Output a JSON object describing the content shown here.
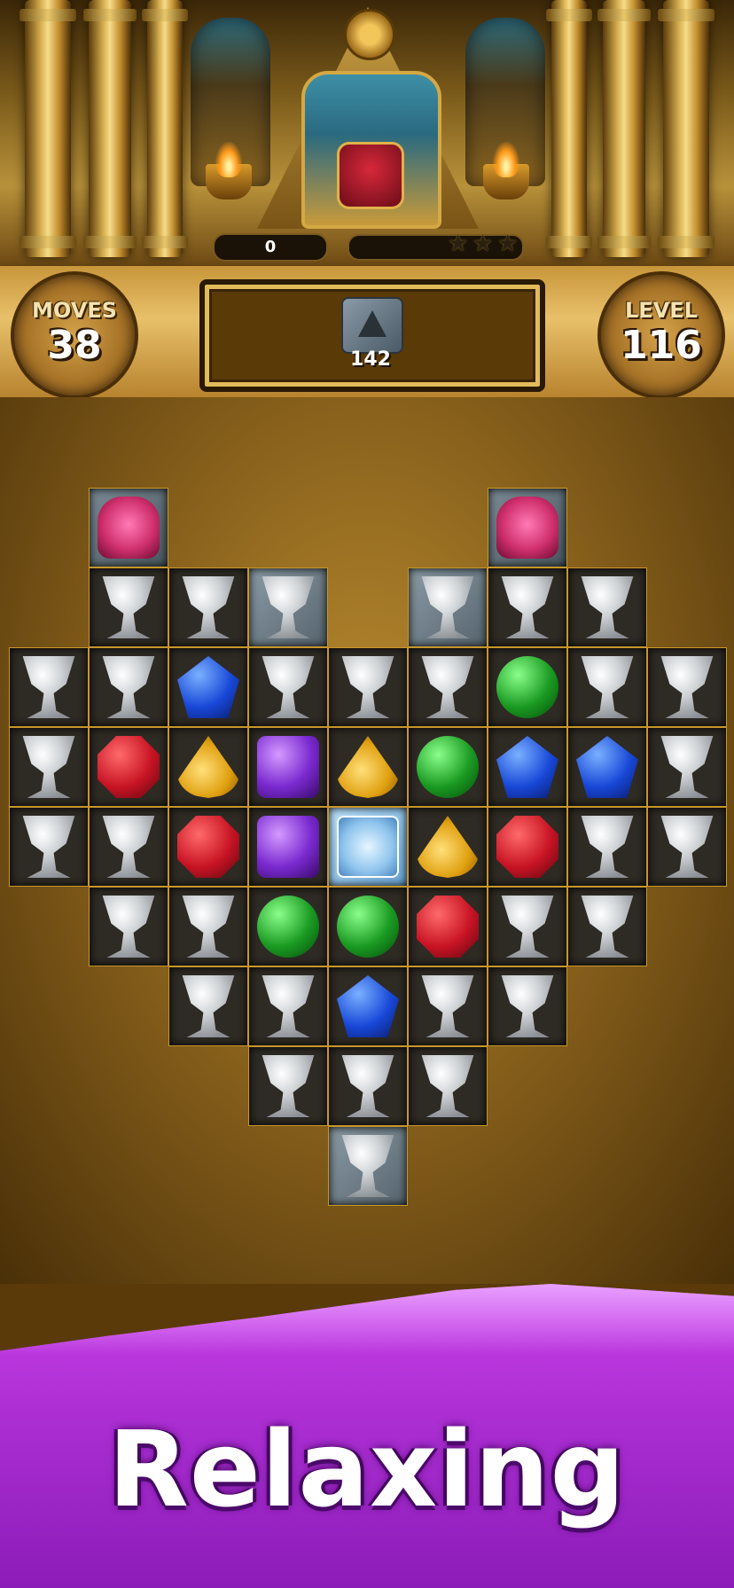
{
  "scene": {
    "score": "0",
    "progress": 0,
    "stars_total": 3,
    "stars_earned": 0
  },
  "hud": {
    "moves_label": "MOVES",
    "moves_value": "38",
    "level_label": "LEVEL",
    "level_value": "116",
    "goal": {
      "icon": "stone-block-icon",
      "count": "142"
    }
  },
  "board": {
    "rows": [
      [
        null,
        "scarab",
        null,
        null,
        null,
        null,
        "scarab",
        null,
        null
      ],
      [
        null,
        "chalice",
        "chalice",
        "chalice",
        null,
        "chalice",
        "chalice",
        "chalice",
        null
      ],
      [
        "chalice",
        "chalice",
        "blue",
        "chalice",
        "chalice",
        "chalice",
        "green",
        "chalice",
        "chalice"
      ],
      [
        "chalice",
        "red",
        "yellow",
        "purple",
        "yellow",
        "green",
        "blue",
        "blue",
        "chalice"
      ],
      [
        "chalice",
        "chalice",
        "red",
        "purple",
        "ice",
        "yellow",
        "red",
        "chalice",
        "chalice"
      ],
      [
        null,
        "chalice",
        "chalice",
        "green",
        "green",
        "red",
        "chalice",
        "chalice",
        null
      ],
      [
        null,
        null,
        "chalice",
        "chalice",
        "blue",
        "chalice",
        "chalice",
        null,
        null
      ],
      [
        null,
        null,
        null,
        "chalice",
        "chalice",
        "chalice",
        null,
        null,
        null
      ],
      [
        null,
        null,
        null,
        null,
        "chalice",
        null,
        null,
        null,
        null
      ]
    ],
    "stone_cells": [
      [
        0,
        1
      ],
      [
        0,
        6
      ],
      [
        1,
        3
      ],
      [
        1,
        5
      ],
      [
        8,
        4
      ]
    ]
  },
  "banner": {
    "text": "Relaxing"
  },
  "colors": {
    "gold": "#e2bb5a",
    "banner_purple": "#a82cd0",
    "gem_red": "#c81424",
    "gem_blue": "#1848d8",
    "gem_green": "#1a9a22",
    "gem_purple": "#7a2ad0",
    "gem_yellow": "#e0a010"
  }
}
